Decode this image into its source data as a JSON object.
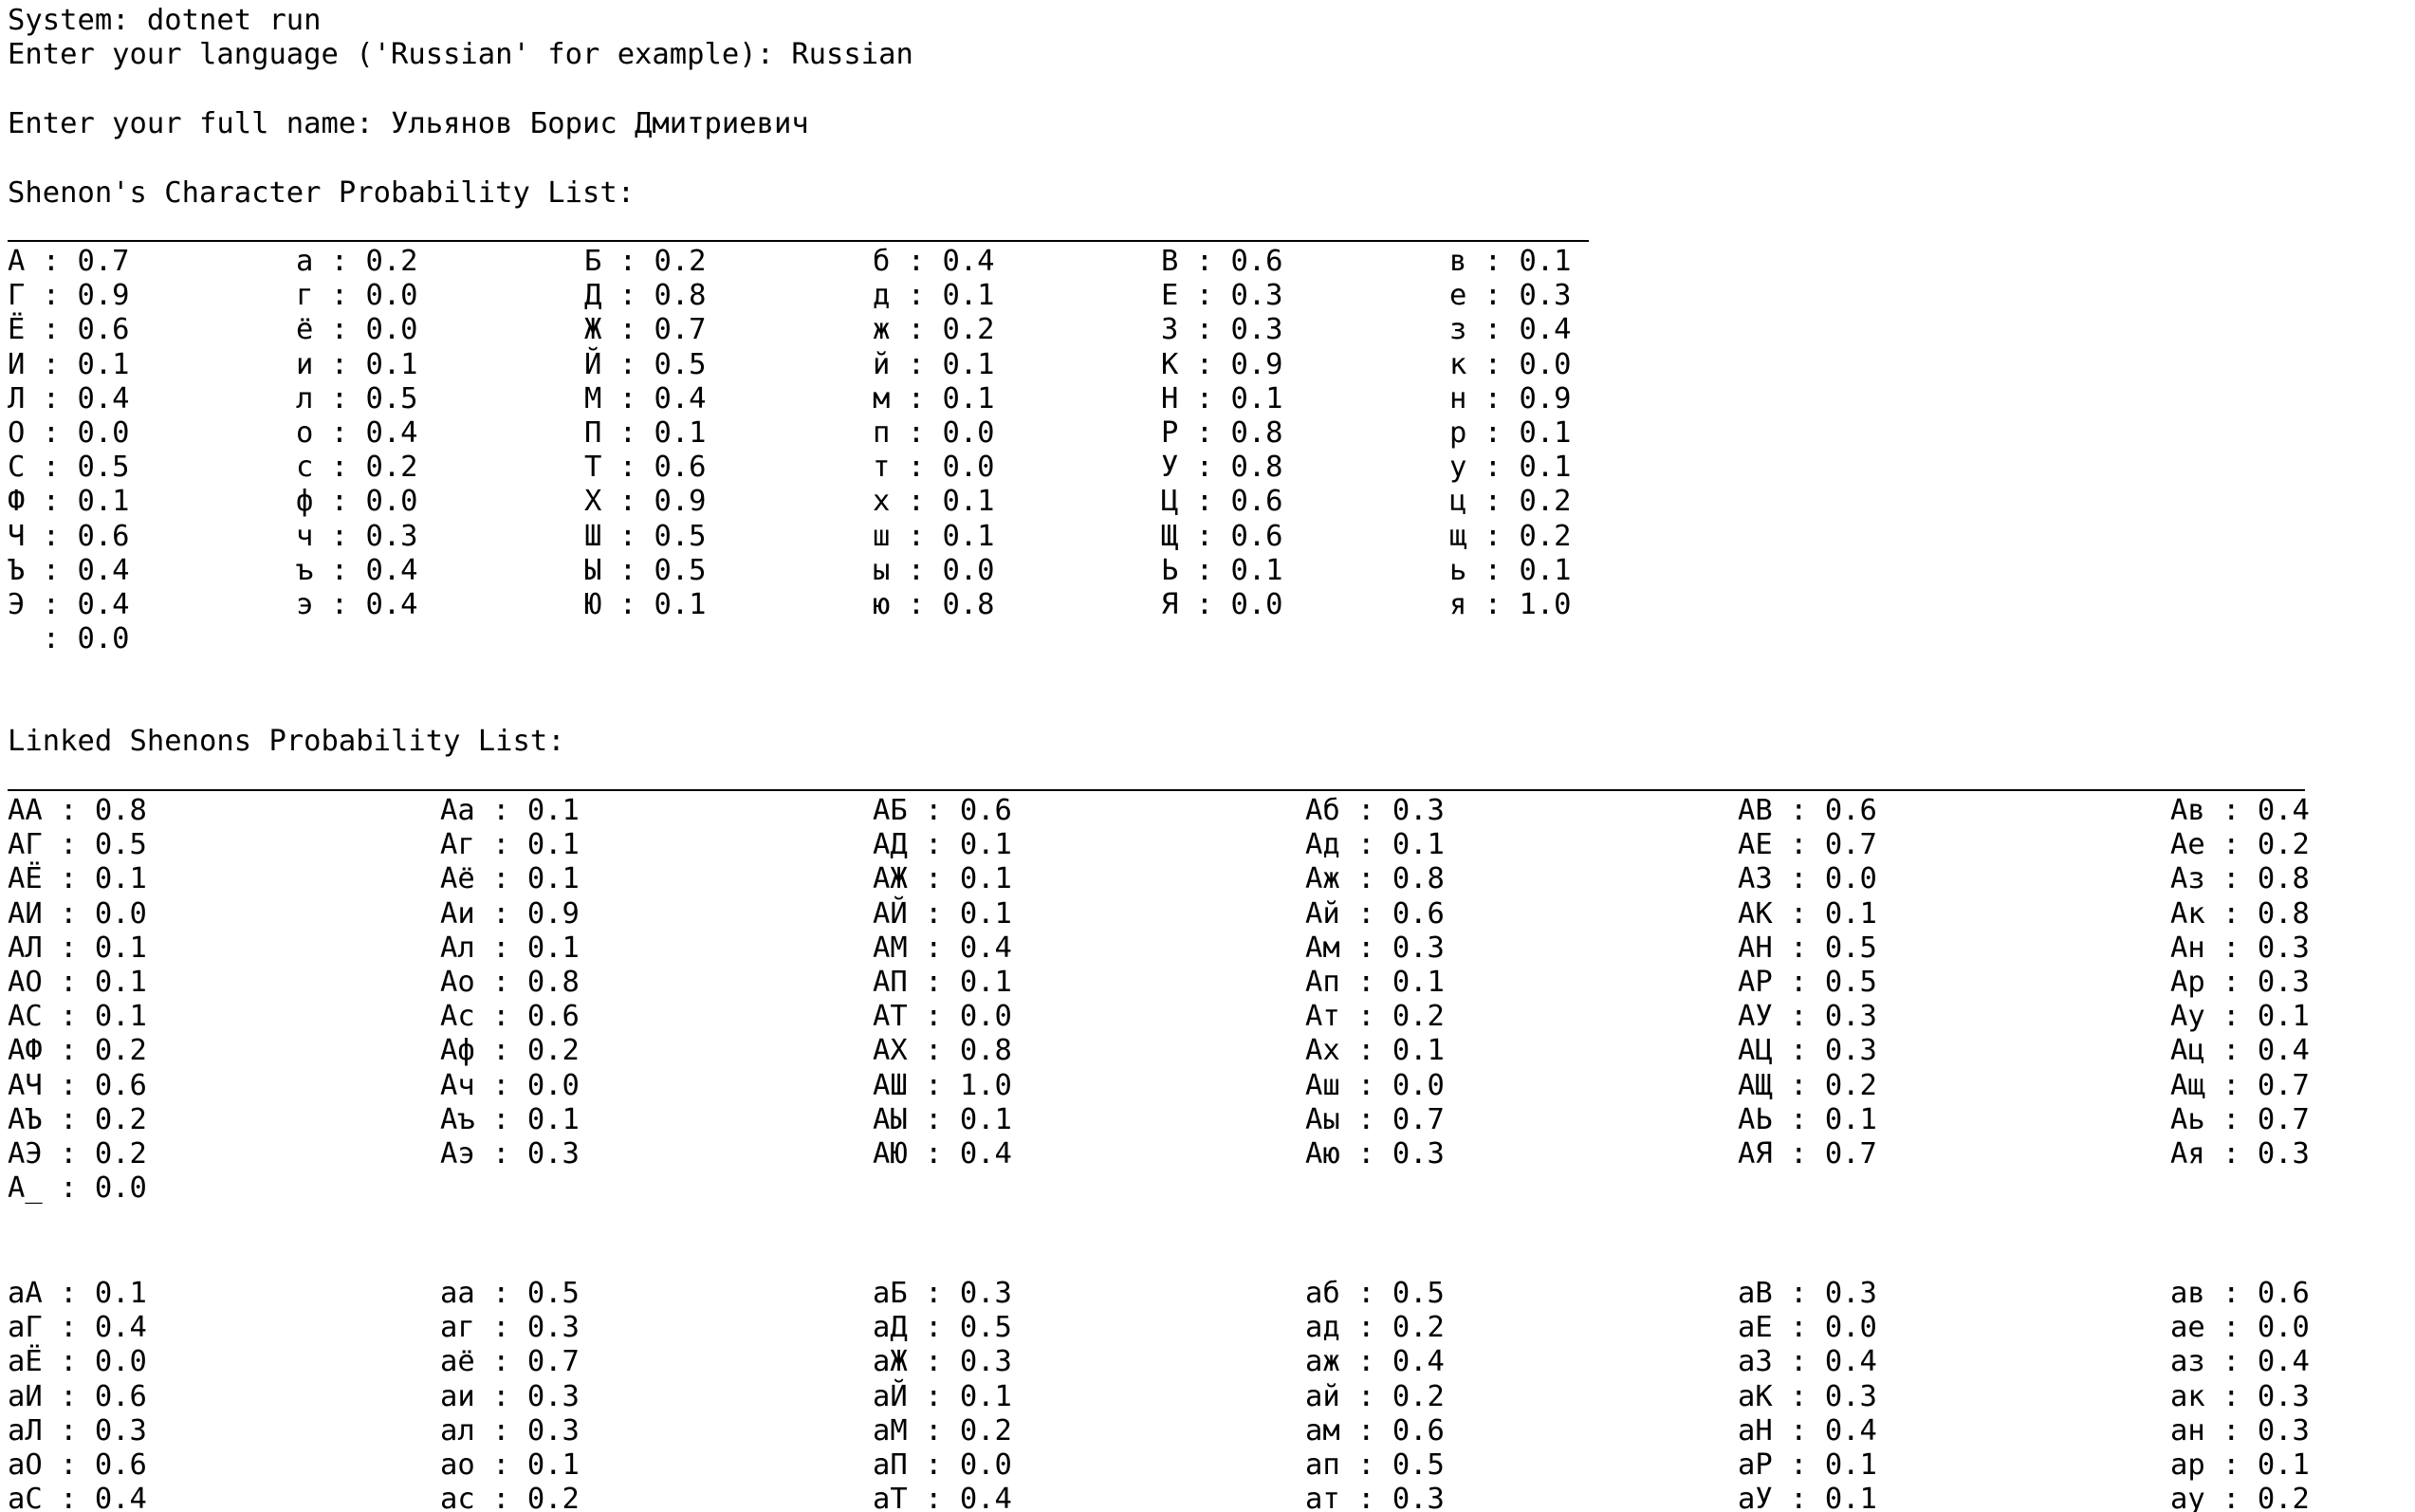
{
  "console": {
    "line_system": "System: dotnet run",
    "line_language": "Enter your language ('Russian' for example): Russian",
    "line_name": "Enter your full name: Ульянов Борис Дмитриевич",
    "char_list_title": "Shenon's Character Probability List:",
    "linked_list_title": "Linked Shenons Probability List:"
  },
  "char_table": [
    [
      "А : 0.7",
      "а : 0.2",
      "Б : 0.2",
      "б : 0.4",
      "В : 0.6",
      "в : 0.1"
    ],
    [
      "Г : 0.9",
      "г : 0.0",
      "Д : 0.8",
      "д : 0.1",
      "Е : 0.3",
      "е : 0.3"
    ],
    [
      "Ё : 0.6",
      "ё : 0.0",
      "Ж : 0.7",
      "ж : 0.2",
      "З : 0.3",
      "з : 0.4"
    ],
    [
      "И : 0.1",
      "и : 0.1",
      "Й : 0.5",
      "й : 0.1",
      "К : 0.9",
      "к : 0.0"
    ],
    [
      "Л : 0.4",
      "л : 0.5",
      "М : 0.4",
      "м : 0.1",
      "Н : 0.1",
      "н : 0.9"
    ],
    [
      "О : 0.0",
      "о : 0.4",
      "П : 0.1",
      "п : 0.0",
      "Р : 0.8",
      "р : 0.1"
    ],
    [
      "С : 0.5",
      "с : 0.2",
      "Т : 0.6",
      "т : 0.0",
      "У : 0.8",
      "у : 0.1"
    ],
    [
      "Ф : 0.1",
      "ф : 0.0",
      "Х : 0.9",
      "х : 0.1",
      "Ц : 0.6",
      "ц : 0.2"
    ],
    [
      "Ч : 0.6",
      "ч : 0.3",
      "Ш : 0.5",
      "ш : 0.1",
      "Щ : 0.6",
      "щ : 0.2"
    ],
    [
      "Ъ : 0.4",
      "ъ : 0.4",
      "Ы : 0.5",
      "ы : 0.0",
      "Ь : 0.1",
      "ь : 0.1"
    ],
    [
      "Э : 0.4",
      "э : 0.4",
      "Ю : 0.1",
      "ю : 0.8",
      "Я : 0.0",
      "я : 1.0"
    ],
    [
      "  : 0.0"
    ]
  ],
  "linked_table_A": [
    [
      "АА : 0.8",
      "Аа : 0.1",
      "АБ : 0.6",
      "Аб : 0.3",
      "АВ : 0.6",
      "Ав : 0.4"
    ],
    [
      "АГ : 0.5",
      "Аг : 0.1",
      "АД : 0.1",
      "Ад : 0.1",
      "АЕ : 0.7",
      "Ае : 0.2"
    ],
    [
      "АЁ : 0.1",
      "Аё : 0.1",
      "АЖ : 0.1",
      "Аж : 0.8",
      "АЗ : 0.0",
      "Аз : 0.8"
    ],
    [
      "АИ : 0.0",
      "Аи : 0.9",
      "АЙ : 0.1",
      "Ай : 0.6",
      "АК : 0.1",
      "Ак : 0.8"
    ],
    [
      "АЛ : 0.1",
      "Ал : 0.1",
      "АМ : 0.4",
      "Ам : 0.3",
      "АН : 0.5",
      "Ан : 0.3"
    ],
    [
      "АО : 0.1",
      "Ао : 0.8",
      "АП : 0.1",
      "Ап : 0.1",
      "АР : 0.5",
      "Ар : 0.3"
    ],
    [
      "АС : 0.1",
      "Ас : 0.6",
      "АТ : 0.0",
      "Ат : 0.2",
      "АУ : 0.3",
      "Ау : 0.1"
    ],
    [
      "АФ : 0.2",
      "Аф : 0.2",
      "АХ : 0.8",
      "Ах : 0.1",
      "АЦ : 0.3",
      "Ац : 0.4"
    ],
    [
      "АЧ : 0.6",
      "Ач : 0.0",
      "АШ : 1.0",
      "Аш : 0.0",
      "АЩ : 0.2",
      "Ащ : 0.7"
    ],
    [
      "АЪ : 0.2",
      "Аъ : 0.1",
      "АЫ : 0.1",
      "Аы : 0.7",
      "АЬ : 0.1",
      "Аь : 0.7"
    ],
    [
      "АЭ : 0.2",
      "Аэ : 0.3",
      "АЮ : 0.4",
      "Аю : 0.3",
      "АЯ : 0.7",
      "Ая : 0.3"
    ],
    [
      "А_ : 0.0"
    ]
  ],
  "linked_table_a": [
    [
      "аА : 0.1",
      "аа : 0.5",
      "аБ : 0.3",
      "аб : 0.5",
      "аВ : 0.3",
      "ав : 0.6"
    ],
    [
      "аГ : 0.4",
      "аг : 0.3",
      "аД : 0.5",
      "ад : 0.2",
      "аЕ : 0.0",
      "ае : 0.0"
    ],
    [
      "аЁ : 0.0",
      "аё : 0.7",
      "аЖ : 0.3",
      "аж : 0.4",
      "аЗ : 0.4",
      "аз : 0.4"
    ],
    [
      "аИ : 0.6",
      "аи : 0.3",
      "аЙ : 0.1",
      "ай : 0.2",
      "аК : 0.3",
      "ак : 0.3"
    ],
    [
      "аЛ : 0.3",
      "ал : 0.3",
      "аМ : 0.2",
      "ам : 0.6",
      "аН : 0.4",
      "ан : 0.3"
    ],
    [
      "аО : 0.6",
      "ао : 0.1",
      "аП : 0.0",
      "ап : 0.5",
      "аР : 0.1",
      "ар : 0.1"
    ],
    [
      "аС : 0.4",
      "ас : 0.2",
      "аТ : 0.4",
      "ат : 0.3",
      "аУ : 0.1",
      "ау : 0.2"
    ]
  ]
}
